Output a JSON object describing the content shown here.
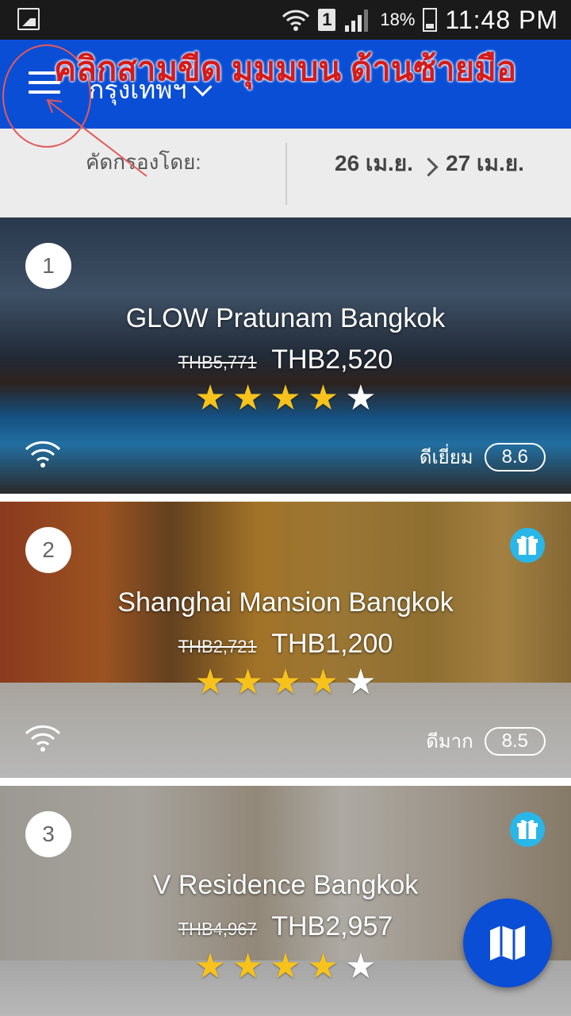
{
  "status_bar": {
    "battery_percent": "18%",
    "sim_slot": "1",
    "time": "11:48 PM"
  },
  "app_bar": {
    "city": "กรุงเทพฯ"
  },
  "filter_bar": {
    "filter_label": "คัดกรองโดย:",
    "checkin": "26 เม.ย.",
    "checkout": "27 เม.ย."
  },
  "annotation": {
    "instruction": "คลิกสามขีด มุมมบน ด้านซ้ายมือ",
    "color": "#d41b1b"
  },
  "hotels": [
    {
      "rank": "1",
      "name": "GLOW Pratunam Bangkok",
      "old_price": "THB5,771",
      "price": "THB2,520",
      "stars": 4,
      "rating_label": "ดีเยี่ยม",
      "rating": "8.6",
      "gift": false
    },
    {
      "rank": "2",
      "name": "Shanghai Mansion Bangkok",
      "old_price": "THB2,721",
      "price": "THB1,200",
      "stars": 4,
      "rating_label": "ดีมาก",
      "rating": "8.5",
      "gift": true
    },
    {
      "rank": "3",
      "name": "V Residence Bangkok",
      "old_price": "THB4,967",
      "price": "THB2,957",
      "stars": 4,
      "gift": true
    }
  ],
  "colors": {
    "app_bar": "#0b4ed6",
    "star": "#f7c21b",
    "annotation": "#d41b1b"
  },
  "icons": {
    "menu": "hamburger-menu-icon",
    "map": "map-icon",
    "wifi": "wifi-icon",
    "gift": "gift-icon"
  }
}
